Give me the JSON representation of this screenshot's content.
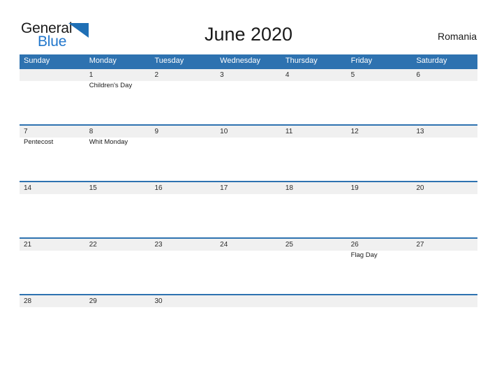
{
  "brand": {
    "name_part1": "General",
    "name_part2": "Blue",
    "flag_icon": "flag-triangle-icon",
    "accent_color": "#2277cc"
  },
  "header": {
    "title": "June 2020",
    "country": "Romania"
  },
  "theme": {
    "header_blue": "#2e72b0",
    "band_gray": "#f0f0f0",
    "text_dark": "#1a1a1a"
  },
  "calendar": {
    "weekdays": [
      "Sunday",
      "Monday",
      "Tuesday",
      "Wednesday",
      "Thursday",
      "Friday",
      "Saturday"
    ],
    "weeks": [
      [
        {
          "date": "",
          "event": ""
        },
        {
          "date": "1",
          "event": "Children's Day"
        },
        {
          "date": "2",
          "event": ""
        },
        {
          "date": "3",
          "event": ""
        },
        {
          "date": "4",
          "event": ""
        },
        {
          "date": "5",
          "event": ""
        },
        {
          "date": "6",
          "event": ""
        }
      ],
      [
        {
          "date": "7",
          "event": "Pentecost"
        },
        {
          "date": "8",
          "event": "Whit Monday"
        },
        {
          "date": "9",
          "event": ""
        },
        {
          "date": "10",
          "event": ""
        },
        {
          "date": "11",
          "event": ""
        },
        {
          "date": "12",
          "event": ""
        },
        {
          "date": "13",
          "event": ""
        }
      ],
      [
        {
          "date": "14",
          "event": ""
        },
        {
          "date": "15",
          "event": ""
        },
        {
          "date": "16",
          "event": ""
        },
        {
          "date": "17",
          "event": ""
        },
        {
          "date": "18",
          "event": ""
        },
        {
          "date": "19",
          "event": ""
        },
        {
          "date": "20",
          "event": ""
        }
      ],
      [
        {
          "date": "21",
          "event": ""
        },
        {
          "date": "22",
          "event": ""
        },
        {
          "date": "23",
          "event": ""
        },
        {
          "date": "24",
          "event": ""
        },
        {
          "date": "25",
          "event": ""
        },
        {
          "date": "26",
          "event": "Flag Day"
        },
        {
          "date": "27",
          "event": ""
        }
      ],
      [
        {
          "date": "28",
          "event": ""
        },
        {
          "date": "29",
          "event": ""
        },
        {
          "date": "30",
          "event": ""
        },
        {
          "date": "",
          "event": ""
        },
        {
          "date": "",
          "event": ""
        },
        {
          "date": "",
          "event": ""
        },
        {
          "date": "",
          "event": ""
        }
      ]
    ]
  }
}
